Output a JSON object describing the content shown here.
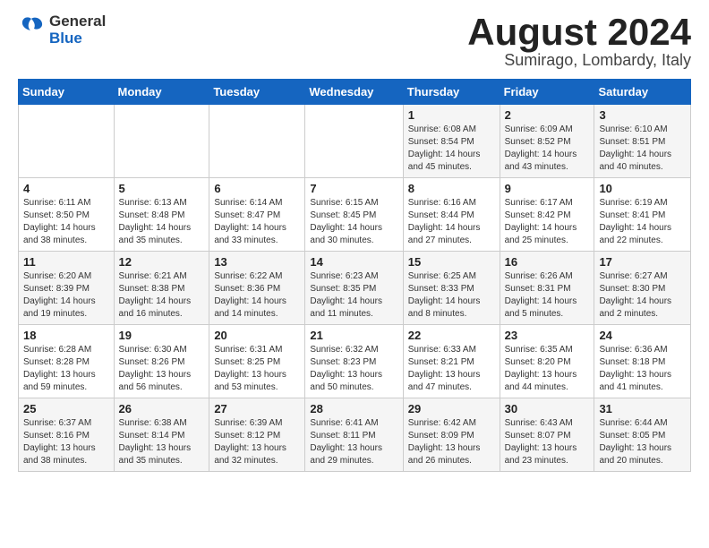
{
  "header": {
    "logo_general": "General",
    "logo_blue": "Blue",
    "month_title": "August 2024",
    "location": "Sumirago, Lombardy, Italy"
  },
  "calendar": {
    "days_of_week": [
      "Sunday",
      "Monday",
      "Tuesday",
      "Wednesday",
      "Thursday",
      "Friday",
      "Saturday"
    ],
    "weeks": [
      [
        {
          "day": "",
          "info": ""
        },
        {
          "day": "",
          "info": ""
        },
        {
          "day": "",
          "info": ""
        },
        {
          "day": "",
          "info": ""
        },
        {
          "day": "1",
          "info": "Sunrise: 6:08 AM\nSunset: 8:54 PM\nDaylight: 14 hours\nand 45 minutes."
        },
        {
          "day": "2",
          "info": "Sunrise: 6:09 AM\nSunset: 8:52 PM\nDaylight: 14 hours\nand 43 minutes."
        },
        {
          "day": "3",
          "info": "Sunrise: 6:10 AM\nSunset: 8:51 PM\nDaylight: 14 hours\nand 40 minutes."
        }
      ],
      [
        {
          "day": "4",
          "info": "Sunrise: 6:11 AM\nSunset: 8:50 PM\nDaylight: 14 hours\nand 38 minutes."
        },
        {
          "day": "5",
          "info": "Sunrise: 6:13 AM\nSunset: 8:48 PM\nDaylight: 14 hours\nand 35 minutes."
        },
        {
          "day": "6",
          "info": "Sunrise: 6:14 AM\nSunset: 8:47 PM\nDaylight: 14 hours\nand 33 minutes."
        },
        {
          "day": "7",
          "info": "Sunrise: 6:15 AM\nSunset: 8:45 PM\nDaylight: 14 hours\nand 30 minutes."
        },
        {
          "day": "8",
          "info": "Sunrise: 6:16 AM\nSunset: 8:44 PM\nDaylight: 14 hours\nand 27 minutes."
        },
        {
          "day": "9",
          "info": "Sunrise: 6:17 AM\nSunset: 8:42 PM\nDaylight: 14 hours\nand 25 minutes."
        },
        {
          "day": "10",
          "info": "Sunrise: 6:19 AM\nSunset: 8:41 PM\nDaylight: 14 hours\nand 22 minutes."
        }
      ],
      [
        {
          "day": "11",
          "info": "Sunrise: 6:20 AM\nSunset: 8:39 PM\nDaylight: 14 hours\nand 19 minutes."
        },
        {
          "day": "12",
          "info": "Sunrise: 6:21 AM\nSunset: 8:38 PM\nDaylight: 14 hours\nand 16 minutes."
        },
        {
          "day": "13",
          "info": "Sunrise: 6:22 AM\nSunset: 8:36 PM\nDaylight: 14 hours\nand 14 minutes."
        },
        {
          "day": "14",
          "info": "Sunrise: 6:23 AM\nSunset: 8:35 PM\nDaylight: 14 hours\nand 11 minutes."
        },
        {
          "day": "15",
          "info": "Sunrise: 6:25 AM\nSunset: 8:33 PM\nDaylight: 14 hours\nand 8 minutes."
        },
        {
          "day": "16",
          "info": "Sunrise: 6:26 AM\nSunset: 8:31 PM\nDaylight: 14 hours\nand 5 minutes."
        },
        {
          "day": "17",
          "info": "Sunrise: 6:27 AM\nSunset: 8:30 PM\nDaylight: 14 hours\nand 2 minutes."
        }
      ],
      [
        {
          "day": "18",
          "info": "Sunrise: 6:28 AM\nSunset: 8:28 PM\nDaylight: 13 hours\nand 59 minutes."
        },
        {
          "day": "19",
          "info": "Sunrise: 6:30 AM\nSunset: 8:26 PM\nDaylight: 13 hours\nand 56 minutes."
        },
        {
          "day": "20",
          "info": "Sunrise: 6:31 AM\nSunset: 8:25 PM\nDaylight: 13 hours\nand 53 minutes."
        },
        {
          "day": "21",
          "info": "Sunrise: 6:32 AM\nSunset: 8:23 PM\nDaylight: 13 hours\nand 50 minutes."
        },
        {
          "day": "22",
          "info": "Sunrise: 6:33 AM\nSunset: 8:21 PM\nDaylight: 13 hours\nand 47 minutes."
        },
        {
          "day": "23",
          "info": "Sunrise: 6:35 AM\nSunset: 8:20 PM\nDaylight: 13 hours\nand 44 minutes."
        },
        {
          "day": "24",
          "info": "Sunrise: 6:36 AM\nSunset: 8:18 PM\nDaylight: 13 hours\nand 41 minutes."
        }
      ],
      [
        {
          "day": "25",
          "info": "Sunrise: 6:37 AM\nSunset: 8:16 PM\nDaylight: 13 hours\nand 38 minutes."
        },
        {
          "day": "26",
          "info": "Sunrise: 6:38 AM\nSunset: 8:14 PM\nDaylight: 13 hours\nand 35 minutes."
        },
        {
          "day": "27",
          "info": "Sunrise: 6:39 AM\nSunset: 8:12 PM\nDaylight: 13 hours\nand 32 minutes."
        },
        {
          "day": "28",
          "info": "Sunrise: 6:41 AM\nSunset: 8:11 PM\nDaylight: 13 hours\nand 29 minutes."
        },
        {
          "day": "29",
          "info": "Sunrise: 6:42 AM\nSunset: 8:09 PM\nDaylight: 13 hours\nand 26 minutes."
        },
        {
          "day": "30",
          "info": "Sunrise: 6:43 AM\nSunset: 8:07 PM\nDaylight: 13 hours\nand 23 minutes."
        },
        {
          "day": "31",
          "info": "Sunrise: 6:44 AM\nSunset: 8:05 PM\nDaylight: 13 hours\nand 20 minutes."
        }
      ]
    ]
  }
}
